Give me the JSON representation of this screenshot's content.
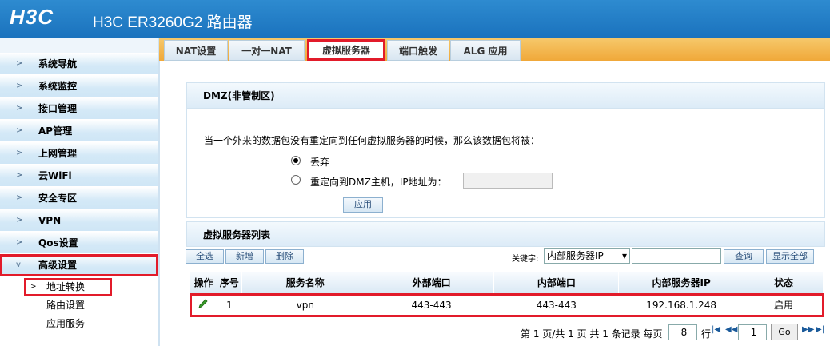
{
  "header": {
    "logo": "H3C",
    "title": "H3C ER3260G2 路由器"
  },
  "sidebar": {
    "items": [
      {
        "label": "系统导航"
      },
      {
        "label": "系统监控"
      },
      {
        "label": "接口管理"
      },
      {
        "label": "AP管理"
      },
      {
        "label": "上网管理"
      },
      {
        "label": "云WiFi"
      },
      {
        "label": "安全专区"
      },
      {
        "label": "VPN"
      },
      {
        "label": "Qos设置"
      },
      {
        "label": "高级设置"
      }
    ],
    "subitems": [
      {
        "label": "地址转换"
      },
      {
        "label": "路由设置"
      },
      {
        "label": "应用服务"
      }
    ]
  },
  "tabs": [
    {
      "label": "NAT设置"
    },
    {
      "label": "一对一NAT"
    },
    {
      "label": "虚拟服务器"
    },
    {
      "label": "端口触发"
    },
    {
      "label": "ALG 应用"
    }
  ],
  "dmz": {
    "title": "DMZ(非管制区)",
    "description": "当一个外来的数据包没有重定向到任何虚拟服务器的时候，那么该数据包将被：",
    "option_drop": "丢弃",
    "option_redirect": "重定向到DMZ主机，IP地址为：",
    "ip_value": "",
    "apply_label": "应用"
  },
  "list": {
    "title": "虚拟服务器列表",
    "select_all": "全选",
    "add": "新增",
    "delete": "删除",
    "keyword_label": "关键字:",
    "keyword_option": "内部服务器IP",
    "search_value": "",
    "search_button": "查询",
    "show_all_button": "显示全部",
    "columns": [
      "操作",
      "序号",
      "服务名称",
      "外部端口",
      "内部端口",
      "内部服务器IP",
      "状态"
    ],
    "rows": [
      {
        "index": "1",
        "name": "vpn",
        "external_port": "443-443",
        "internal_port": "443-443",
        "ip": "192.168.1.248",
        "status": "启用"
      }
    ]
  },
  "pagination": {
    "summary": "第 1 页/共 1 页 共 1 条记录 每页",
    "per_page": "8",
    "rows_label": "行",
    "page_value": "1",
    "go_label": "Go"
  },
  "colors": {
    "highlight": "#e21b2a",
    "header_blue": "#1a72bd",
    "tab_orange": "#f0a839"
  }
}
